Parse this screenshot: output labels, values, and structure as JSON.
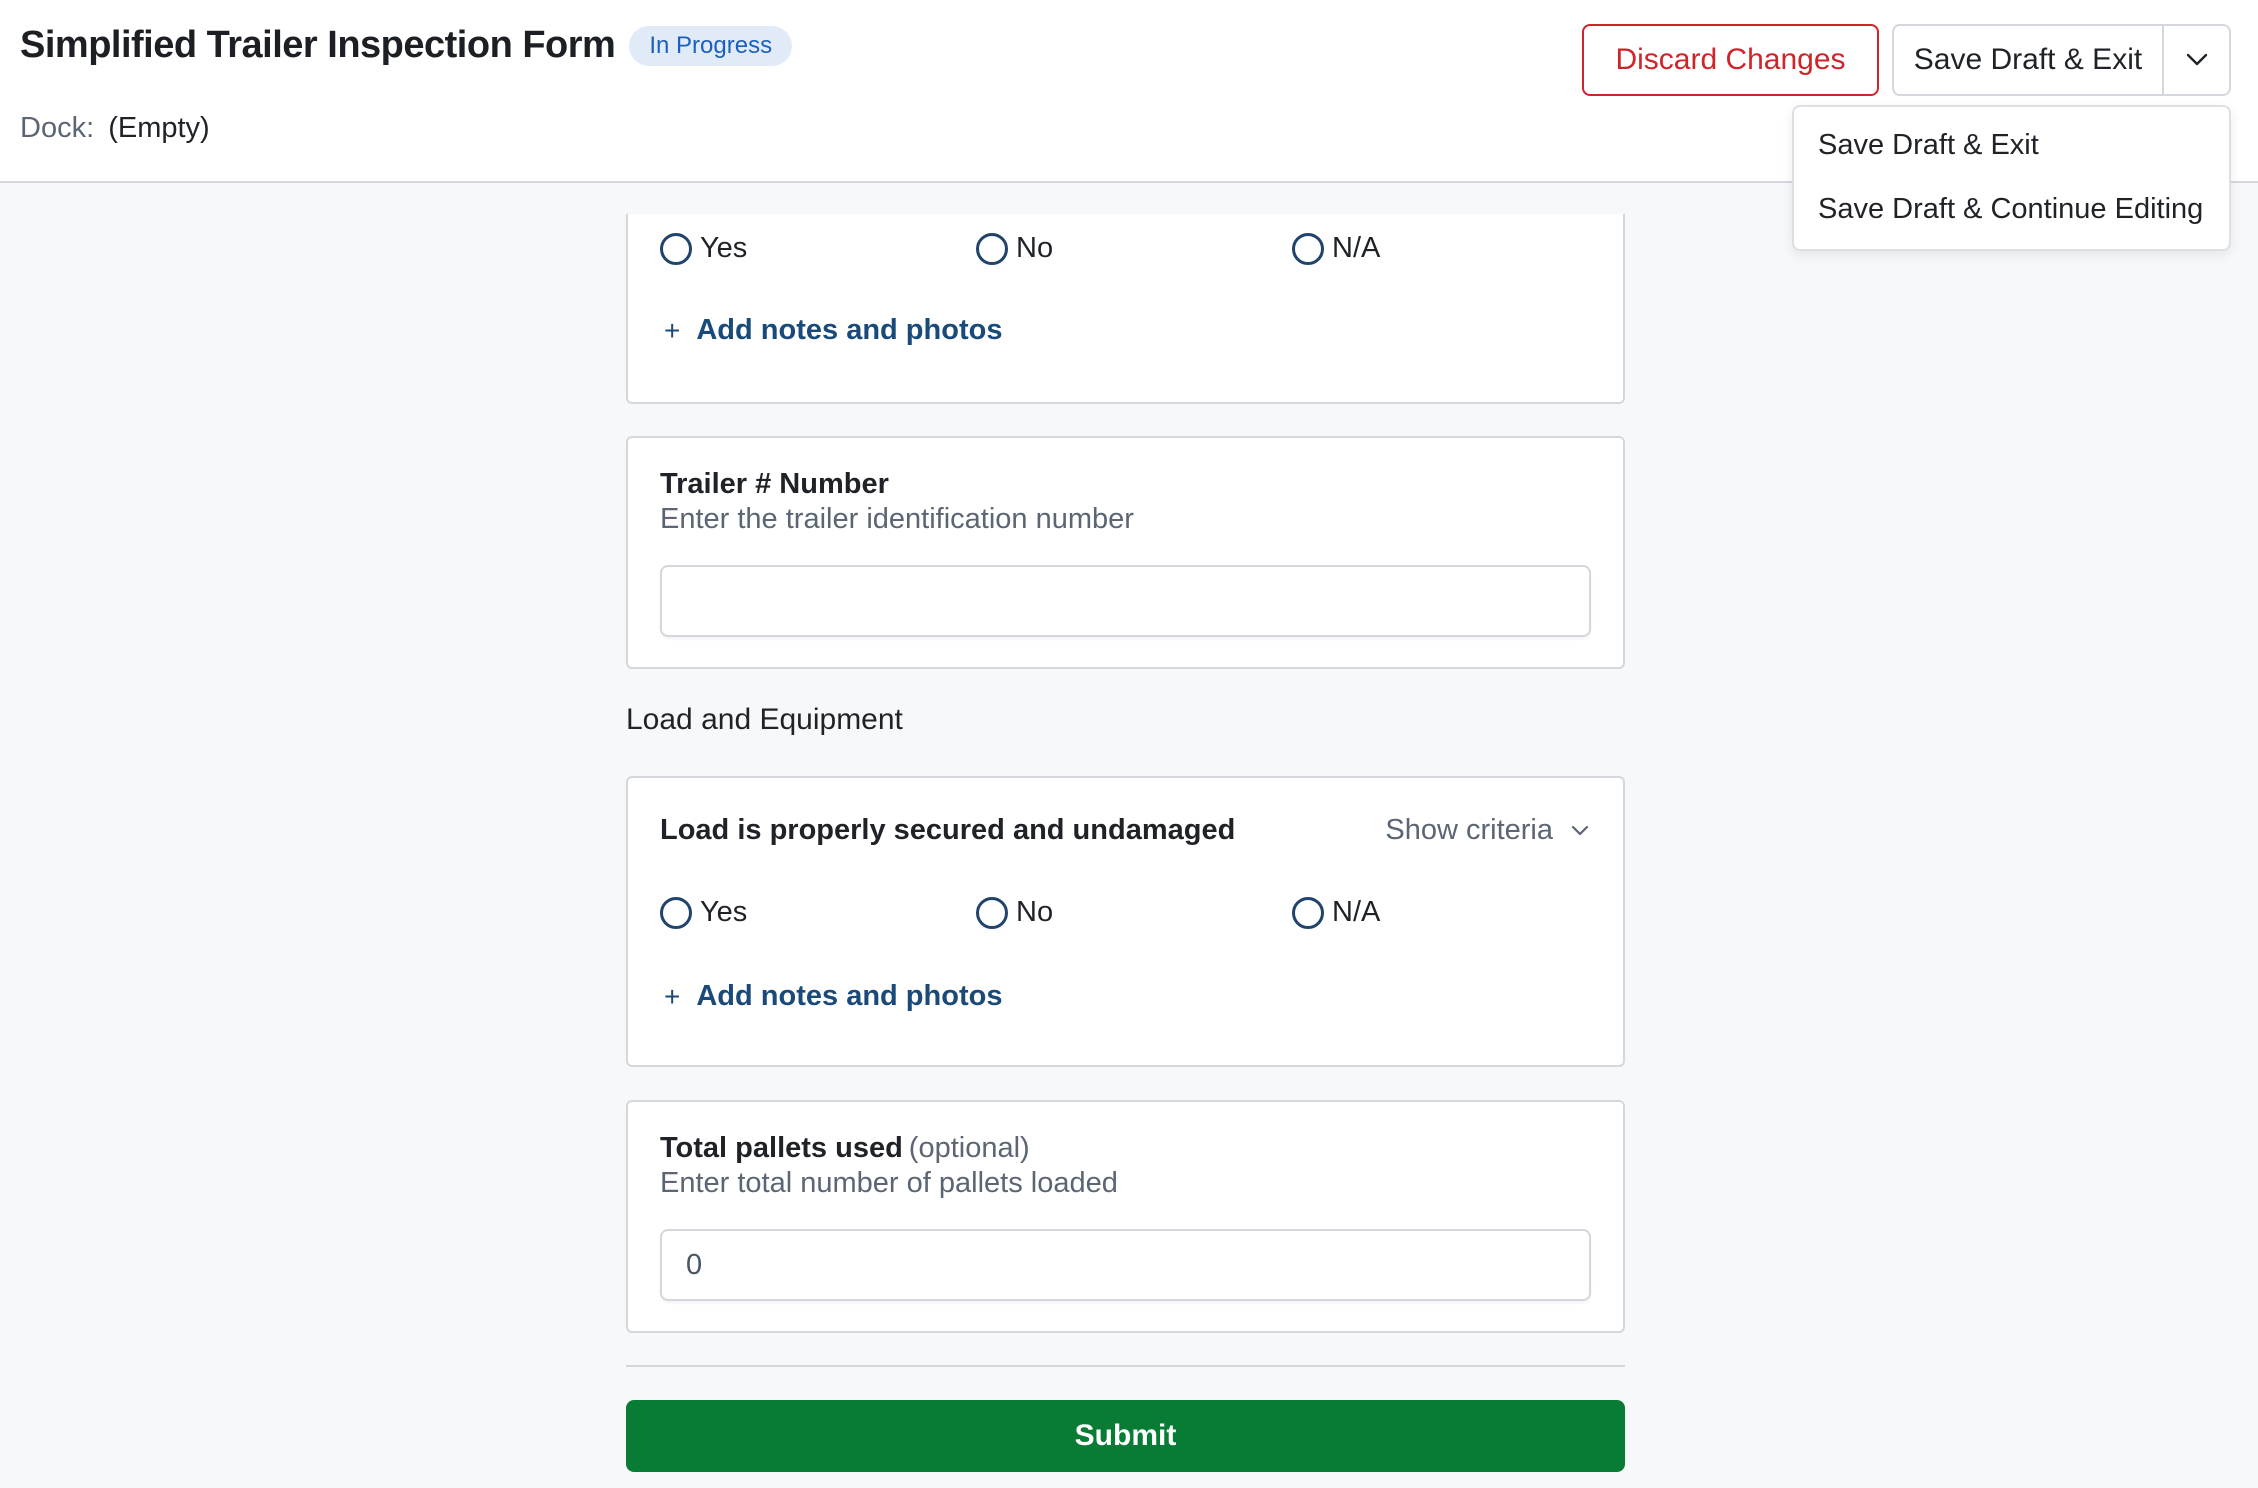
{
  "header": {
    "title": "Simplified Trailer Inspection Form",
    "status_badge": "In Progress",
    "dock_label": "Dock:",
    "dock_value": "(Empty)",
    "discard_label": "Discard Changes",
    "save_exit_label": "Save Draft & Exit"
  },
  "save_menu": {
    "items": [
      {
        "label": "Save Draft & Exit"
      },
      {
        "label": "Save Draft & Continue Editing"
      }
    ]
  },
  "prev_question": {
    "options": [
      {
        "label": "Yes"
      },
      {
        "label": "No"
      },
      {
        "label": "N/A"
      }
    ],
    "add_notes": "Add notes and photos"
  },
  "trailer_number": {
    "title": "Trailer # Number",
    "description": "Enter the trailer identification number",
    "value": ""
  },
  "section": {
    "heading": "Load and Equipment"
  },
  "load_question": {
    "title": "Load is properly secured and undamaged",
    "show_criteria": "Show criteria",
    "options": [
      {
        "label": "Yes"
      },
      {
        "label": "No"
      },
      {
        "label": "N/A"
      }
    ],
    "add_notes": "Add notes and photos"
  },
  "pallets": {
    "title": "Total pallets used",
    "optional": "(optional)",
    "description": "Enter total number of pallets loaded",
    "value": "0"
  },
  "submit_label": "Submit",
  "colors": {
    "accent_link": "#1a4a7a",
    "danger": "#d0242b",
    "submit_green": "#087b34",
    "badge_bg": "#e1ebf8",
    "badge_text": "#1c5fbf"
  }
}
